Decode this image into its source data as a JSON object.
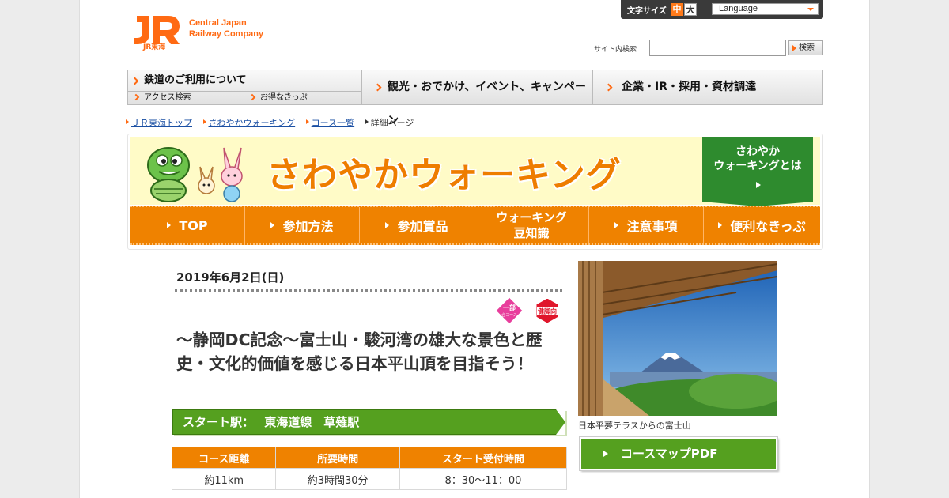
{
  "header": {
    "logo_sub": "JR東海",
    "company_en_line1": "Central Japan",
    "company_en_line2": "Railway Company",
    "font_size_label": "文字サイズ",
    "font_size_mid": "中",
    "font_size_large": "大",
    "language_label": "Language",
    "search_label": "サイト内検索",
    "search_placeholder": "",
    "search_button": "検索"
  },
  "global_nav": {
    "railway_use": "鉄道のご利用について",
    "access_search": "アクセス検索",
    "bargain_tickets": "お得なきっぷ",
    "sightseeing": "観光・おでかけ、イベント、キャンペーン",
    "corporate": "企業・IR・採用・資材調達"
  },
  "breadcrumb": [
    "ＪＲ東海トップ",
    "さわやかウォーキング",
    "コース一覧",
    "詳細ページ"
  ],
  "banner": {
    "title": "さわやかウォーキング",
    "about_line1": "さわやか",
    "about_line2": "ウォーキングとは",
    "nav": [
      {
        "label": "TOP"
      },
      {
        "label": "参加方法"
      },
      {
        "label": "参加賞品"
      },
      {
        "label_line1": "ウォーキング",
        "label_line2": "豆知識"
      },
      {
        "label": "注意事項"
      },
      {
        "label": "便利なきっぷ"
      }
    ]
  },
  "event": {
    "date": "2019年6月2日(日)",
    "badge_partial": "一部",
    "badge_partial_sub": "合コース",
    "badge_difficulty": "健脚向",
    "title": "～静岡DC記念～富士山・駿河湾の雄大な景色と歴史・文化的価値を感じる日本平山頂を目指そう！",
    "start_label": "スタート駅：",
    "start_station": "東海道線　草薙駅",
    "table_headers": [
      "コース距離",
      "所要時間",
      "スタート受付時間"
    ],
    "table_values": [
      "約11km",
      "約3時間30分",
      "8：30～11：00"
    ],
    "photo_caption": "日本平夢テラスからの富士山",
    "pdf_button": "コースマップPDF"
  },
  "colors": {
    "brand_orange": "#ff6a13",
    "banner_orange": "#ef8200",
    "green": "#55a01f",
    "dark_green": "#2e8b2e"
  }
}
